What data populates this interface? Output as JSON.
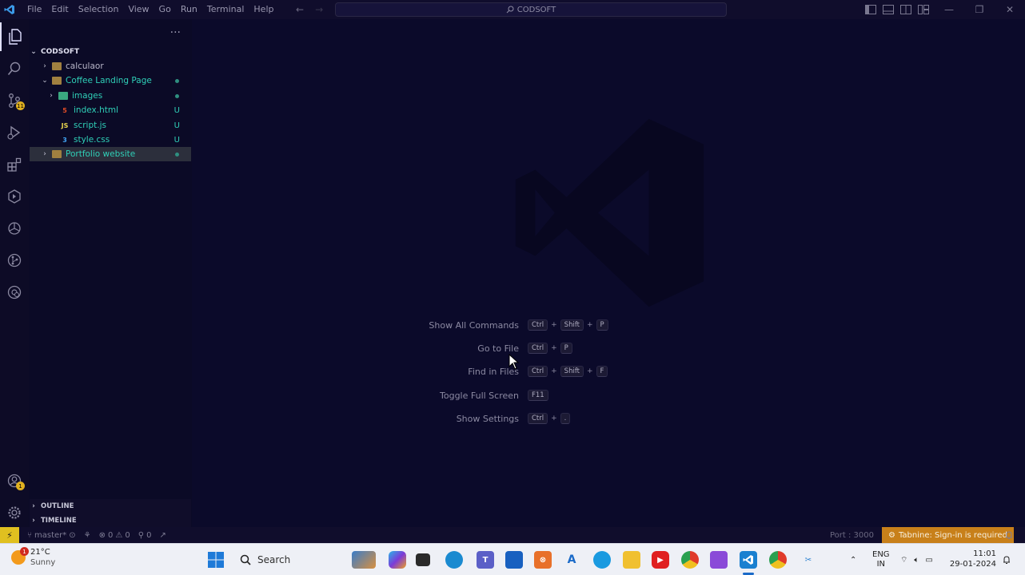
{
  "titlebar": {
    "menu": [
      "File",
      "Edit",
      "Selection",
      "View",
      "Go",
      "Run",
      "Terminal",
      "Help"
    ],
    "search": "CODSOFT"
  },
  "activity": {
    "source_control_badge": "11",
    "accounts_badge": "1"
  },
  "explorer": {
    "root": "CODSOFT",
    "items": [
      {
        "label": "calculaor",
        "status": ""
      },
      {
        "label": "Coffee Landing Page",
        "status": ""
      },
      {
        "label": "images",
        "status": ""
      },
      {
        "label": "index.html",
        "status": "U"
      },
      {
        "label": "script.js",
        "status": "U"
      },
      {
        "label": "style.css",
        "status": "U"
      },
      {
        "label": "Portfolio website",
        "status": ""
      }
    ],
    "outline": "OUTLINE",
    "timeline": "TIMELINE"
  },
  "shortcuts": [
    {
      "label": "Show All Commands",
      "keys": [
        "Ctrl",
        "Shift",
        "P"
      ]
    },
    {
      "label": "Go to File",
      "keys": [
        "Ctrl",
        "P"
      ]
    },
    {
      "label": "Find in Files",
      "keys": [
        "Ctrl",
        "Shift",
        "F"
      ]
    },
    {
      "label": "Toggle Full Screen",
      "keys": [
        "F11"
      ]
    },
    {
      "label": "Show Settings",
      "keys": [
        "Ctrl",
        "."
      ]
    }
  ],
  "statusbar": {
    "branch": "master*",
    "errors": "0",
    "warnings": "0",
    "ports": "0",
    "port_label": "Port : 3000",
    "tabnine": "Tabnine: Sign-in is required"
  },
  "taskbar": {
    "temp": "21°C",
    "weather": "Sunny",
    "weather_badge": "1",
    "search": "Search",
    "lang1": "ENG",
    "lang2": "IN",
    "time": "11:01",
    "date": "29-01-2024"
  },
  "colors": {
    "editor_bg": "#0b0a2a",
    "accent_teal": "#2fd0b8",
    "tabnine": "#c8801a",
    "remote": "#e0c020"
  }
}
